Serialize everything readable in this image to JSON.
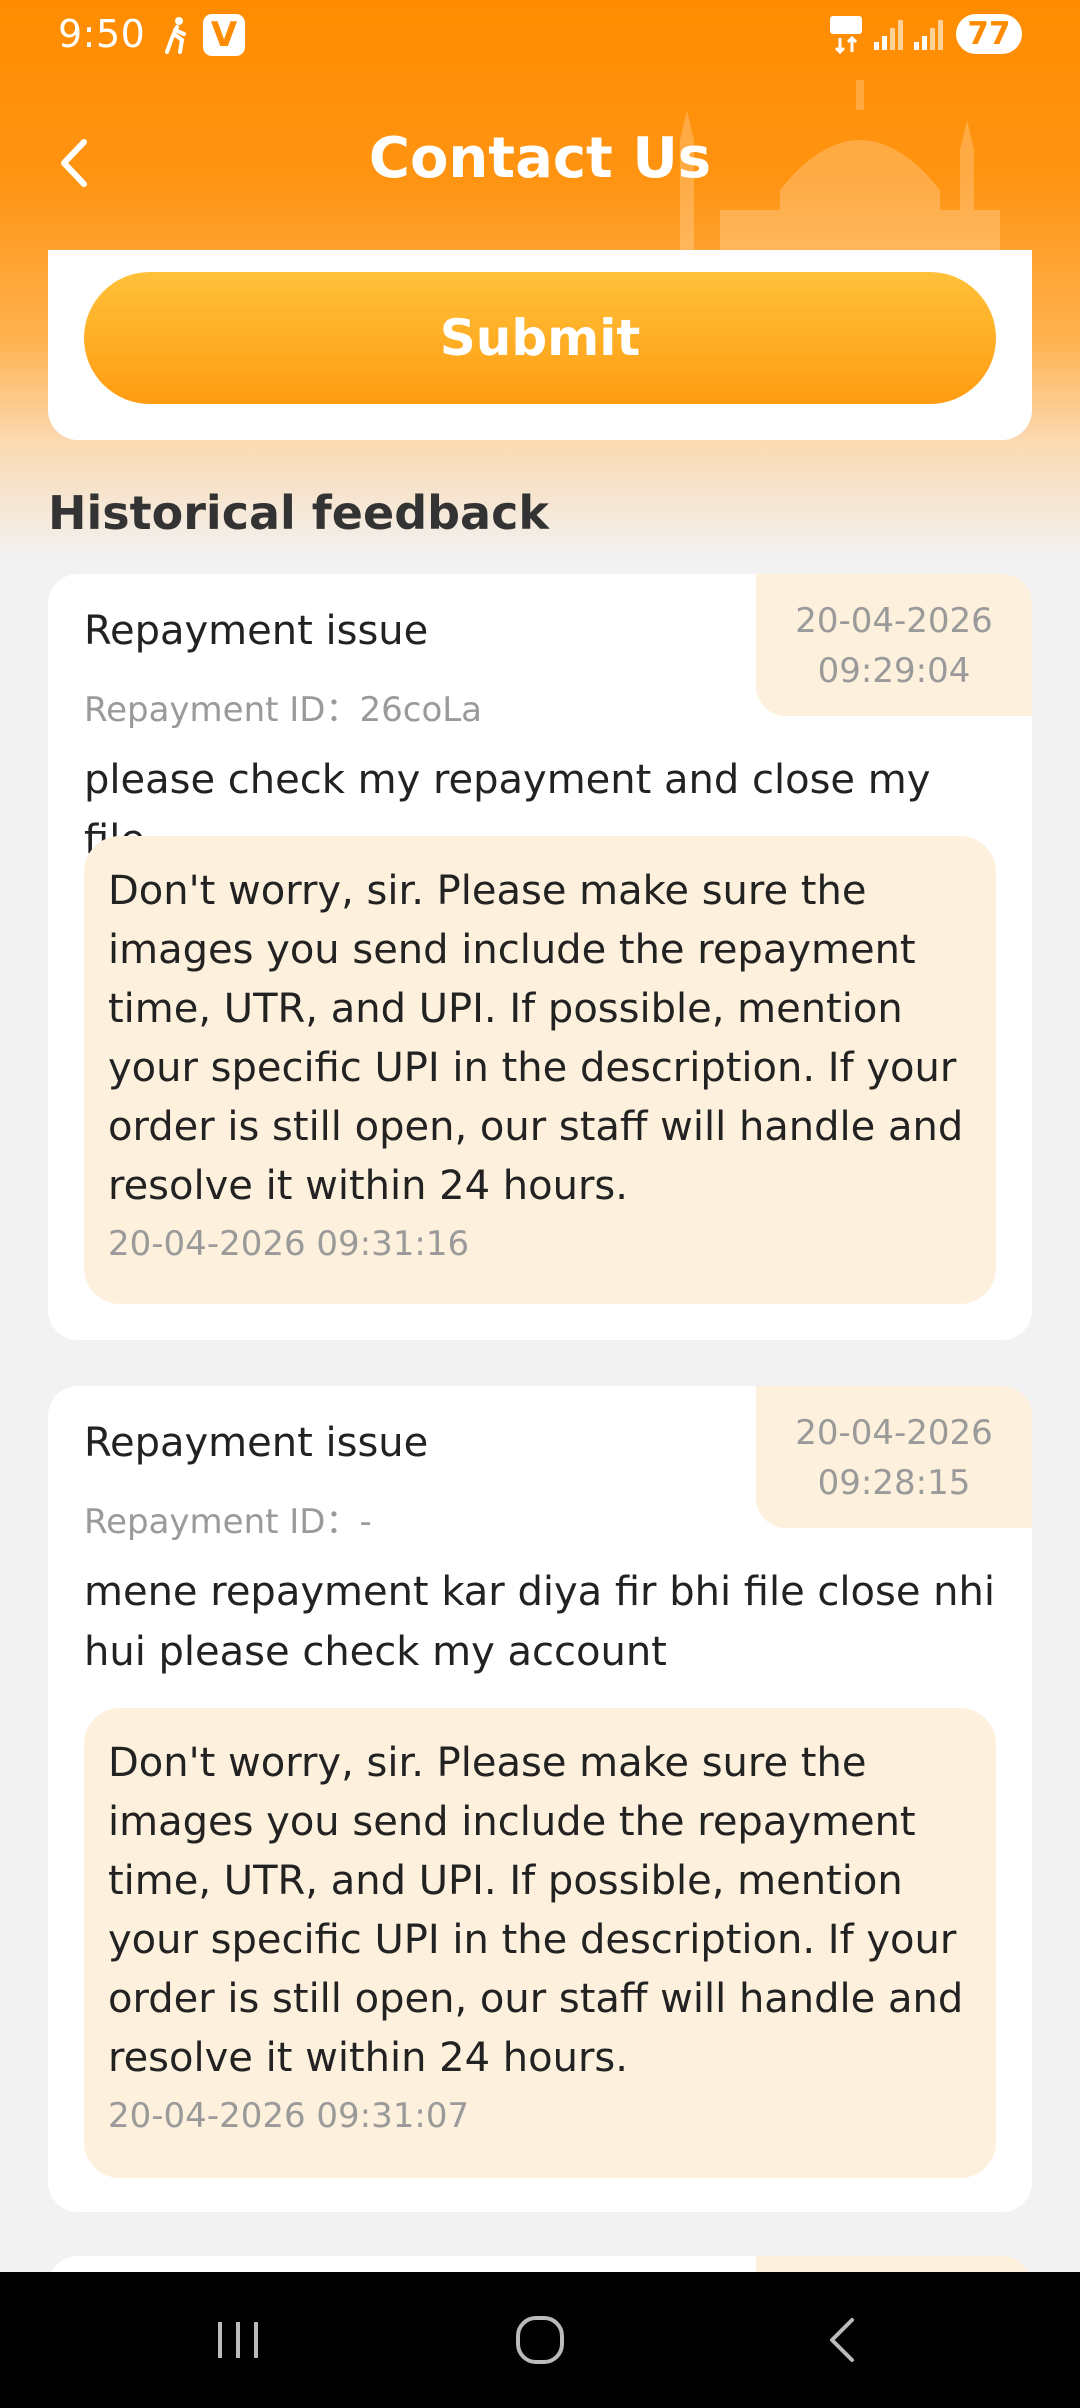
{
  "status_bar": {
    "time": "9:50",
    "app_badge": "V",
    "battery": "77"
  },
  "header": {
    "title": "Contact Us"
  },
  "submit": {
    "label": "Submit"
  },
  "section": {
    "title": "Historical feedback"
  },
  "feedback": [
    {
      "title": "Repayment issue",
      "date": "20-04-2026",
      "time": "09:29:04",
      "repayment_id": "Repayment ID：26coLa",
      "description": "please check my repayment and close my file",
      "reply": "Don't worry, sir. Please make sure the images you send include the repayment time, UTR, and UPI. If possible, mention your specific UPI in the description. If your order is still open, our staff will handle and resolve it within 24 hours.",
      "reply_time": "20-04-2026 09:31:16"
    },
    {
      "title": "Repayment issue",
      "date": "20-04-2026",
      "time": "09:28:15",
      "repayment_id": "Repayment ID：-",
      "description": "mene repayment kar diya fir bhi file close nhi hui please check my account",
      "reply": "Don't worry, sir. Please make sure the images you send include the repayment time, UTR, and UPI. If possible, mention your specific UPI in the description. If your order is still open, our staff will handle and resolve it within 24 hours.",
      "reply_time": "20-04-2026 09:31:07"
    }
  ],
  "colors": {
    "brand": "#ff8c00",
    "button": "#ffaa22",
    "reply_bg": "#fdf0dc",
    "muted": "#9a9a9a"
  }
}
